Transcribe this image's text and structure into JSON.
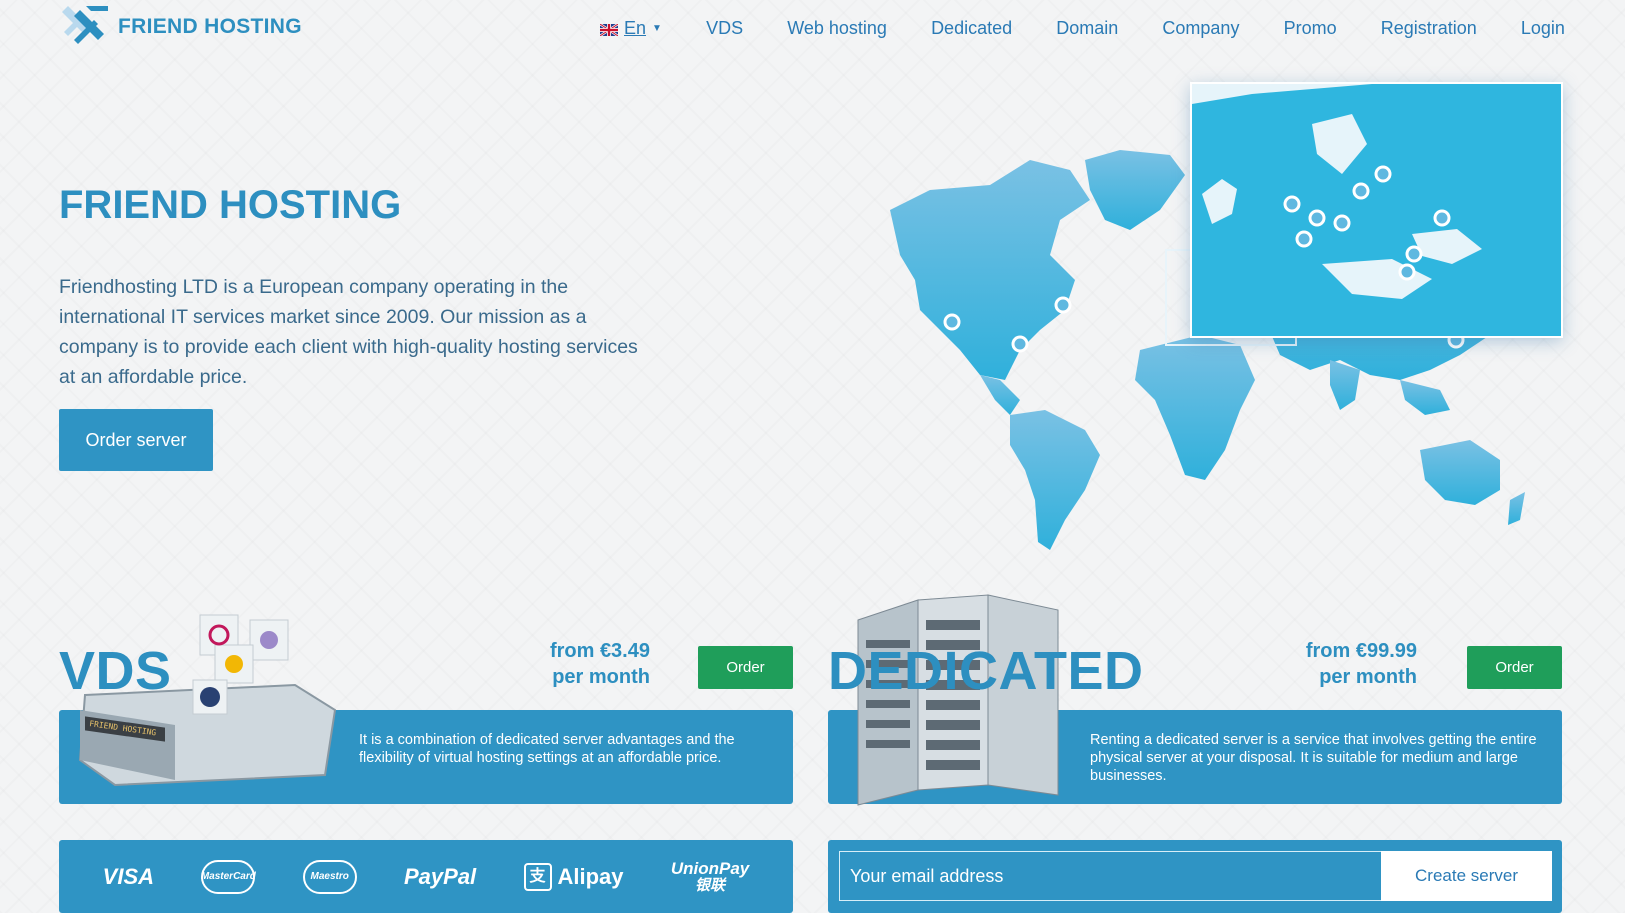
{
  "header": {
    "logo_text": "FRIEND HOSTING",
    "language": "En",
    "nav": {
      "vds": "VDS",
      "web_hosting": "Web hosting",
      "dedicated": "Dedicated",
      "domain": "Domain",
      "company": "Company",
      "promo": "Promo",
      "registration": "Registration",
      "login": "Login"
    }
  },
  "hero": {
    "title": "FRIEND HOSTING",
    "description": "Friendhosting LTD is a European company operating in the international IT services market since 2009. Our mission as a company is to provide each client with high-quality hosting services at an affordable price.",
    "order_button": "Order server"
  },
  "vds": {
    "title": "VDS",
    "price_line1": "from €3.49",
    "price_line2": "per month",
    "order_button": "Order",
    "description": "It is a combination of dedicated server advantages and the flexibility of virtual hosting settings at an affordable price.",
    "illustration_label": "FRIEND HOSTING"
  },
  "dedicated": {
    "title": "DEDICATED",
    "price_line1": "from €99.99",
    "price_line2": "per month",
    "order_button": "Order",
    "description": "Renting a dedicated server is a service that involves getting the entire physical server at your disposal. It is suitable for medium and large businesses."
  },
  "payments": {
    "visa": "VISA",
    "mastercard": "MasterCard",
    "maestro": "Maestro",
    "paypal": "PayPal",
    "alipay": "Alipay",
    "unionpay": "UnionPay",
    "unionpay_cn": "银联"
  },
  "signup": {
    "email_placeholder": "Your email address",
    "create_button": "Create server"
  },
  "colors": {
    "brand_blue": "#2f94c4",
    "title_blue": "#2d8fc0",
    "order_green": "#1f9e5a",
    "map_blue": "#36b3dc"
  },
  "icons": {
    "logo": "friend-hosting-logo-icon",
    "flag": "uk-flag-icon",
    "caret": "caret-down-icon",
    "map_marker": "location-pin-icon"
  }
}
